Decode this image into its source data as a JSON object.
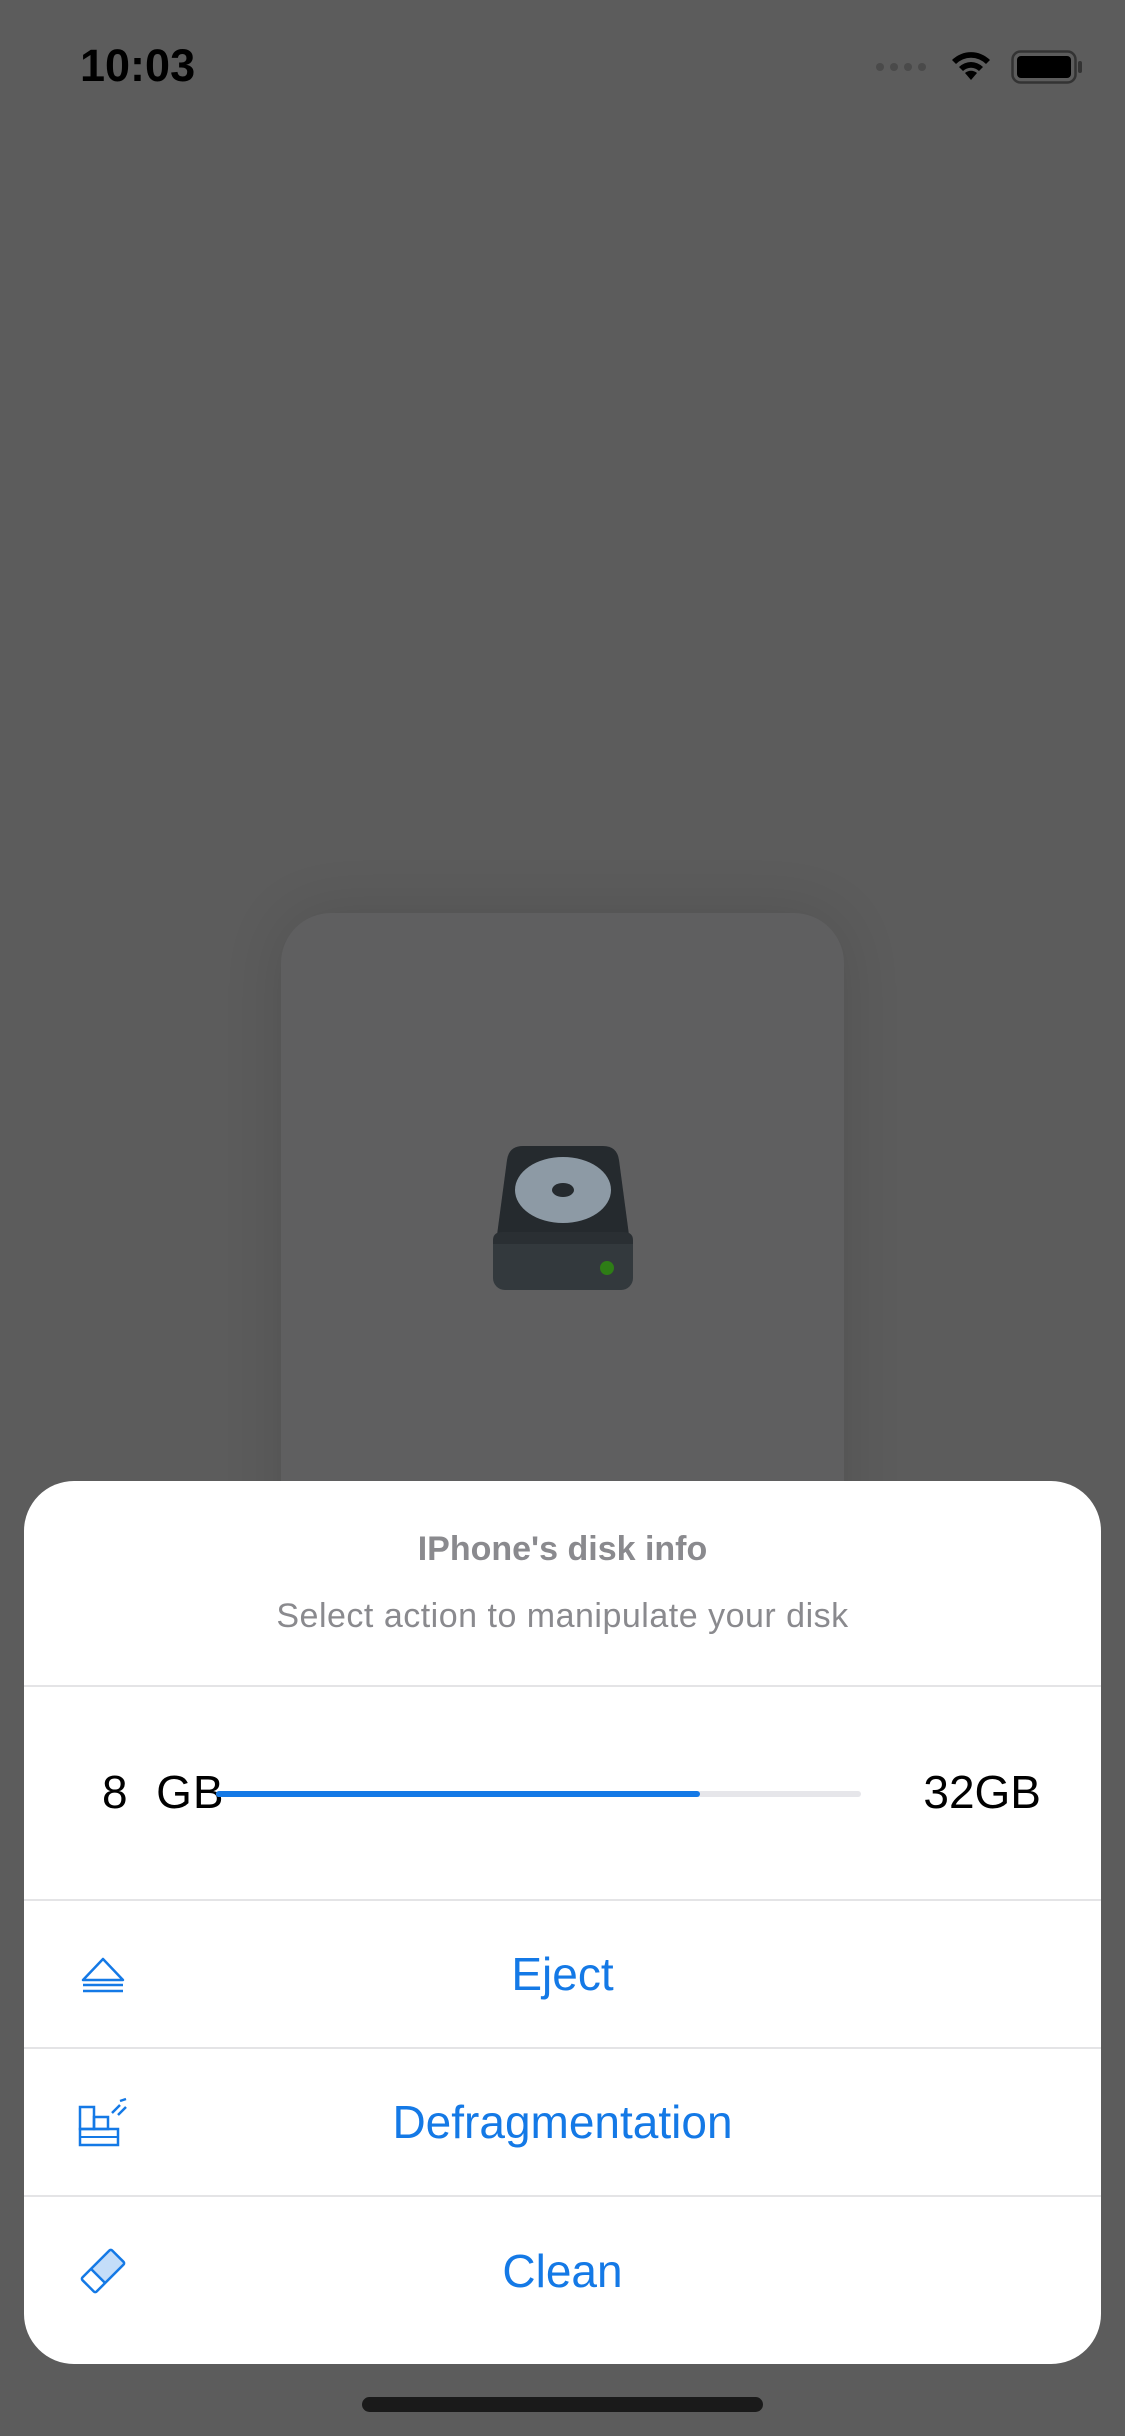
{
  "status_bar": {
    "time": "10:03",
    "icons": [
      "signal-icon",
      "wifi-icon",
      "battery-icon"
    ]
  },
  "sheet": {
    "title": "IPhone's disk info",
    "subtitle": "Select action to manipulate your disk",
    "usage": {
      "used_label": "8  GB",
      "total_label": "32GB",
      "fill_fraction": 0.75
    },
    "actions": [
      {
        "label": "Eject",
        "icon": "eject-icon"
      },
      {
        "label": "Defragmentation",
        "icon": "defragmentation-icon"
      },
      {
        "label": "Clean",
        "icon": "eraser-icon"
      }
    ]
  },
  "colors": {
    "accent": "#1479e6",
    "overlay": "#5c5c5c",
    "muted_text": "#8a8a8e"
  }
}
